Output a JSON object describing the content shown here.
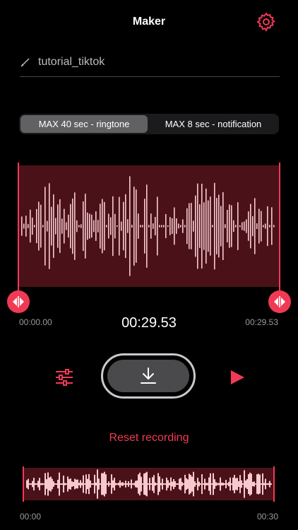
{
  "header": {
    "title": "Maker",
    "settings_icon": "gear-icon"
  },
  "recording": {
    "name": "tutorial_tiktok",
    "edit_icon": "pencil-icon"
  },
  "modes": [
    {
      "label": "MAX 40 sec - ringtone",
      "selected": true
    },
    {
      "label": "MAX 8 sec - notification",
      "selected": false
    }
  ],
  "trim": {
    "start": "00:00.00",
    "end": "00:29.53",
    "duration": "00:29.53"
  },
  "controls": {
    "equalizer_icon": "sliders-icon",
    "download_icon": "download-icon",
    "play_icon": "play-icon"
  },
  "reset_label": "Reset recording",
  "overview": {
    "start": "00:00",
    "end": "00:30"
  },
  "colors": {
    "accent": "#f03a55",
    "wave_bg": "#4a1218",
    "wave": "#f7c9cf"
  }
}
